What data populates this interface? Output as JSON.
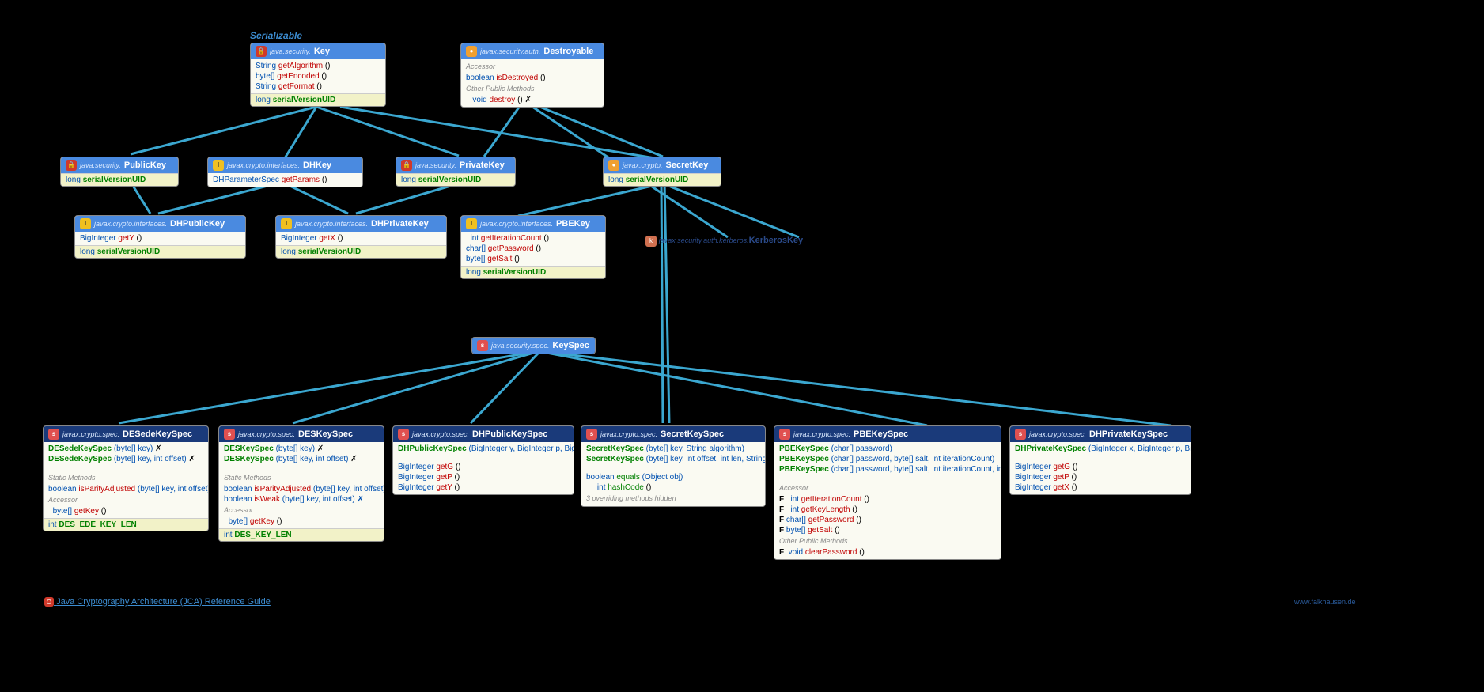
{
  "link_serializable": "Serializable",
  "link_jca": "Java Cryptography Architecture (JCA) Reference Guide",
  "site": "www.falkhausen.de",
  "kerberos": {
    "pkg": "javax.security.auth.kerberos.",
    "cls": "KerberosKey"
  },
  "key": {
    "pkg": "java.security.",
    "cls": "Key",
    "m": [
      [
        "String",
        "getAlgorithm",
        "()"
      ],
      [
        "byte[]",
        "getEncoded",
        "()"
      ],
      [
        "String",
        "getFormat",
        "()"
      ]
    ],
    "svu": "serialVersionUID",
    "svt": "long"
  },
  "destroyable": {
    "pkg": "javax.security.auth.",
    "cls": "Destroyable",
    "acc": "Accessor",
    "m1": [
      [
        "boolean",
        "isDestroyed",
        "()"
      ]
    ],
    "opm": "Other Public Methods",
    "m2": [
      [
        "void",
        "destroy",
        "() ✗"
      ]
    ]
  },
  "publickey": {
    "pkg": "java.security.",
    "cls": "PublicKey",
    "svu": "serialVersionUID",
    "svt": "long"
  },
  "dhkey": {
    "pkg": "javax.crypto.interfaces.",
    "cls": "DHKey",
    "m": [
      [
        "DHParameterSpec",
        "getParams",
        "()"
      ]
    ]
  },
  "privatekey": {
    "pkg": "java.security.",
    "cls": "PrivateKey",
    "svu": "serialVersionUID",
    "svt": "long"
  },
  "secretkey": {
    "pkg": "javax.crypto.",
    "cls": "SecretKey",
    "svu": "serialVersionUID",
    "svt": "long"
  },
  "dhpublickey": {
    "pkg": "javax.crypto.interfaces.",
    "cls": "DHPublicKey",
    "m": [
      [
        "BigInteger",
        "getY",
        "()"
      ]
    ],
    "svu": "serialVersionUID",
    "svt": "long"
  },
  "dhprivatekey": {
    "pkg": "javax.crypto.interfaces.",
    "cls": "DHPrivateKey",
    "m": [
      [
        "BigInteger",
        "getX",
        "()"
      ]
    ],
    "svu": "serialVersionUID",
    "svt": "long"
  },
  "pbekey": {
    "pkg": "javax.crypto.interfaces.",
    "cls": "PBEKey",
    "m": [
      [
        "int",
        "getIterationCount",
        "()"
      ],
      [
        "char[]",
        "getPassword",
        "()"
      ],
      [
        "byte[]",
        "getSalt",
        "()"
      ]
    ],
    "svu": "serialVersionUID",
    "svt": "long"
  },
  "keyspec": {
    "pkg": "java.security.spec.",
    "cls": "KeySpec"
  },
  "desede": {
    "pkg": "javax.crypto.spec.",
    "cls": "DESedeKeySpec",
    "c": [
      "DESedeKeySpec (byte[] key) ✗",
      "DESedeKeySpec (byte[] key, int offset) ✗"
    ],
    "stat": "Static Methods",
    "sm": [
      [
        "boolean",
        "isParityAdjusted",
        "(byte[] key, int offset) ✗"
      ]
    ],
    "acc": "Accessor",
    "am": [
      [
        "byte[]",
        "getKey",
        "()"
      ]
    ],
    "const": "DES_EDE_KEY_LEN",
    "constT": "int"
  },
  "des": {
    "pkg": "javax.crypto.spec.",
    "cls": "DESKeySpec",
    "c": [
      "DESKeySpec (byte[] key) ✗",
      "DESKeySpec (byte[] key, int offset) ✗"
    ],
    "stat": "Static Methods",
    "sm": [
      [
        "boolean",
        "isParityAdjusted",
        "(byte[] key, int offset) ✗"
      ],
      [
        "boolean",
        "isWeak",
        "(byte[] key, int offset) ✗"
      ]
    ],
    "acc": "Accessor",
    "am": [
      [
        "byte[]",
        "getKey",
        "()"
      ]
    ],
    "const": "DES_KEY_LEN",
    "constT": "int"
  },
  "dhpubspec": {
    "pkg": "javax.crypto.spec.",
    "cls": "DHPublicKeySpec",
    "c": [
      "DHPublicKeySpec (BigInteger y, BigInteger p, BigInteger g)"
    ],
    "m": [
      [
        "BigInteger",
        "getG",
        "()"
      ],
      [
        "BigInteger",
        "getP",
        "()"
      ],
      [
        "BigInteger",
        "getY",
        "()"
      ]
    ]
  },
  "sks": {
    "pkg": "javax.crypto.spec.",
    "cls": "SecretKeySpec",
    "c": [
      "SecretKeySpec (byte[] key, String algorithm)",
      "SecretKeySpec (byte[] key, int offset, int len, String algorithm)"
    ],
    "m": [
      [
        "boolean",
        "equals",
        "(Object obj)"
      ],
      [
        "int",
        "hashCode",
        "()"
      ]
    ],
    "ov": "3 overriding methods hidden"
  },
  "pbespec": {
    "pkg": "javax.crypto.spec.",
    "cls": "PBEKeySpec",
    "c": [
      "PBEKeySpec (char[] password)",
      "PBEKeySpec (char[] password, byte[] salt, int iterationCount)",
      "PBEKeySpec (char[] password, byte[] salt, int iterationCount, int keyLength)"
    ],
    "acc": "Accessor",
    "am": [
      [
        "int",
        "getIterationCount",
        "()"
      ],
      [
        "int",
        "getKeyLength",
        "()"
      ],
      [
        "char[]",
        "getPassword",
        "()"
      ],
      [
        "byte[]",
        "getSalt",
        "()"
      ]
    ],
    "opm": "Other Public Methods",
    "om": [
      [
        "void",
        "clearPassword",
        "()"
      ]
    ]
  },
  "dhprivspec": {
    "pkg": "javax.crypto.spec.",
    "cls": "DHPrivateKeySpec",
    "c": [
      "DHPrivateKeySpec (BigInteger x, BigInteger p, BigInteger g)"
    ],
    "m": [
      [
        "BigInteger",
        "getG",
        "()"
      ],
      [
        "BigInteger",
        "getP",
        "()"
      ],
      [
        "BigInteger",
        "getX",
        "()"
      ]
    ]
  }
}
